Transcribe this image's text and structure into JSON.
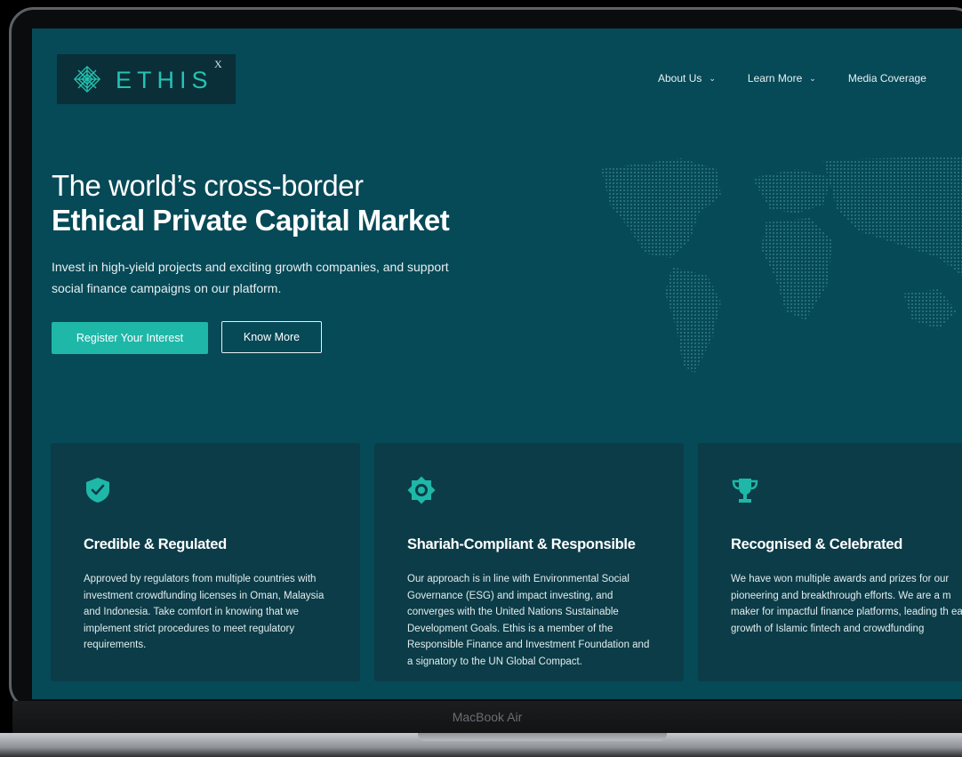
{
  "brand": {
    "name": "ETHIS",
    "superscript": "X"
  },
  "nav": {
    "items": [
      {
        "label": "About Us",
        "has_dropdown": true
      },
      {
        "label": "Learn More",
        "has_dropdown": true
      },
      {
        "label": "Media Coverage",
        "has_dropdown": false
      }
    ]
  },
  "hero": {
    "title_line1": "The world’s cross-border",
    "title_line2": "Ethical Private Capital Market",
    "subtitle": "Invest in high-yield projects and exciting growth companies, and support social finance campaigns on our platform.",
    "primary_button": "Register Your Interest",
    "secondary_button": "Know More"
  },
  "cards": [
    {
      "icon": "shield-check-icon",
      "title": "Credible & Regulated",
      "body": "Approved by regulators from multiple countries with investment crowdfunding licenses in Oman, Malaysia and Indonesia. Take comfort in knowing that we implement strict procedures to meet regulatory requirements."
    },
    {
      "icon": "star-badge-icon",
      "title": "Shariah-Compliant & Responsible",
      "body": "Our approach is in line with Environmental Social Governance (ESG) and impact investing, and converges with the United Nations Sustainable Development Goals. Ethis is a member of the Responsible Finance and Investment Foundation and a signatory to the UN Global Compact."
    },
    {
      "icon": "trophy-icon",
      "title": "Recognised & Celebrated",
      "body": "We have won multiple awards and prizes for our pioneering and breakthrough efforts. We are a m maker for impactful finance platforms, leading th early growth of Islamic fintech and crowdfunding"
    }
  ],
  "device": {
    "label": "MacBook Air"
  },
  "colors": {
    "background": "#064957",
    "accent": "#1fb7a8",
    "card": "#0b3c48"
  }
}
